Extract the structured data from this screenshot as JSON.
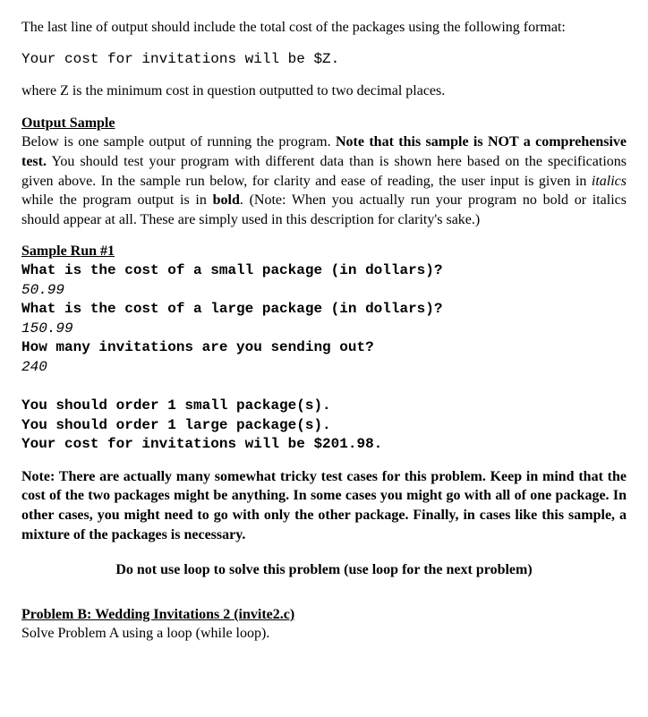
{
  "intro": {
    "line1": "The last line of output should include the total cost of the packages using the following format:",
    "codeLine": "Your cost for invitations will be $Z.",
    "line2": "where Z is the minimum cost in question outputted to two decimal places."
  },
  "outputSample": {
    "heading": "Output Sample",
    "para_part1": "Below is one sample output of running the program. ",
    "para_bold": "Note that this sample is NOT a comprehensive test.",
    "para_part2": " You should test your program with different data than is shown here based on the specifications given above. In the sample run below, for clarity and ease of reading, the user input is given in ",
    "para_italics_word": "italics",
    "para_part3": " while the program output is in ",
    "para_bold_word": "bold",
    "para_part4": ". (Note: When you actually run your program no bold or italics should appear at all. These are simply used in this description for clarity's sake.)"
  },
  "sampleRun": {
    "heading": "Sample Run #1",
    "prompt1": "What is the cost of a small package (in dollars)?",
    "input1": "50.99",
    "prompt2": "What is the cost of a large package (in dollars)?",
    "input2": "150.99",
    "prompt3": "How many invitations are you sending out?",
    "input3": "240",
    "output1": "You should order 1 small package(s).",
    "output2": "You should order 1 large package(s).",
    "output3": "Your cost for invitations will be $201.98."
  },
  "note": "Note: There are actually many somewhat tricky test cases for this problem. Keep in mind that the cost of the two packages might be anything. In some cases you might go with all of one package. In other cases, you might need to go with only the other package. Finally, in cases like this sample, a mixture of the packages is necessary.",
  "noLoop": "Do not use loop to solve this problem (use loop for the next problem)",
  "problemB": {
    "heading": "Problem B:   Wedding Invitations 2 (invite2.c)",
    "line": "Solve Problem A using a loop (while loop)."
  }
}
